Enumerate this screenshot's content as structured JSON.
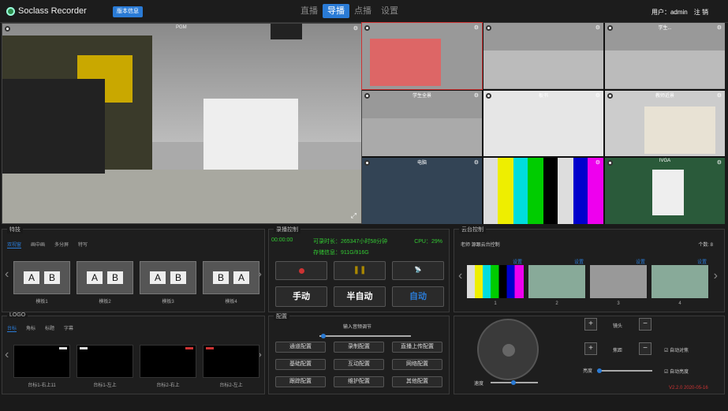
{
  "app": {
    "title": "Soclass Recorder",
    "version_btn": "版本信息"
  },
  "nav": {
    "items": [
      "直播",
      "导播",
      "点播",
      "设置"
    ]
  },
  "user": {
    "label": "用户：admin",
    "logout": "注 销"
  },
  "cells": [
    "",
    "",
    "学生...",
    "学生全景",
    "板书",
    "教师近景",
    "电脑",
    "",
    "IVGA"
  ],
  "mainview_label": "PGM",
  "template": {
    "title": "特技",
    "tabs": [
      "双视窗",
      "画中画",
      "多分屏",
      "特写"
    ],
    "items": [
      {
        "a": "A",
        "b": "B",
        "name": "模板1"
      },
      {
        "a": "A",
        "b": "B",
        "name": "模板2"
      },
      {
        "a": "A",
        "b": "B",
        "name": "模板3"
      },
      {
        "a": "B",
        "b": "A",
        "name": "模板4"
      }
    ]
  },
  "record": {
    "title": "录播控制",
    "time": "00:00:00",
    "rec_len": "可录时长：265347小时58分钟",
    "cpu": "CPU：29%",
    "storage": "存储信息：911G/916G",
    "manual": "手动",
    "semi": "半自动",
    "auto": "自动"
  },
  "ptz": {
    "title": "云台控制",
    "teacher": "老师 源跟云台控制",
    "count": "个数: 8",
    "items": [
      {
        "set": "设置",
        "n": "1"
      },
      {
        "set": "设置",
        "n": "2"
      },
      {
        "set": "设置",
        "n": "3"
      },
      {
        "set": "设置",
        "n": "4"
      }
    ]
  },
  "logo": {
    "title": "LOGO",
    "tabs": [
      "台标",
      "角标",
      "标题",
      "字幕"
    ],
    "items": [
      "台标1-右上11",
      "台标1-左上",
      "台标2-右上",
      "台标2-左上"
    ]
  },
  "config": {
    "title": "配置",
    "volume": "输入音频调节",
    "buttons": [
      "通道配置",
      "录制配置",
      "直播上传配置",
      "基础配置",
      "互动配置",
      "网络配置",
      "跟踪配置",
      "维护配置",
      "其他配置"
    ]
  },
  "ctrl": {
    "lens": "镜头",
    "focus": "焦距",
    "auto_focus": "自动对焦",
    "bright": "亮度",
    "auto_bright": "自动亮度",
    "speed": "速度",
    "ver": "V2.2.0 2020-05-16"
  },
  "colors": {
    "accent": "#2a7bd6",
    "green": "#33cc33",
    "red": "#cc3333"
  }
}
